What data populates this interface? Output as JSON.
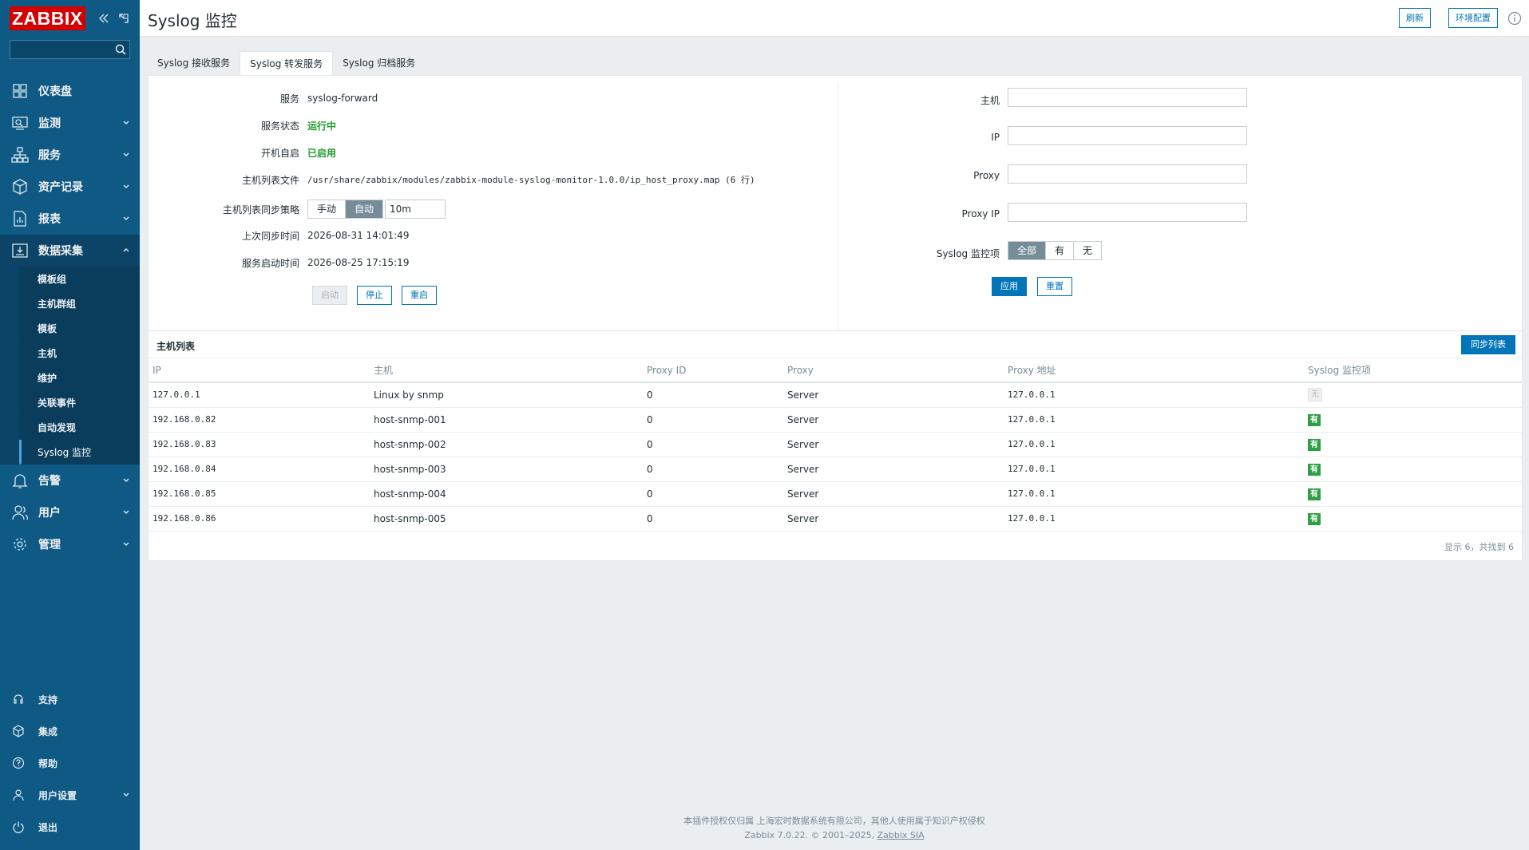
{
  "app": {
    "logo": "ZABBIX",
    "search_placeholder": ""
  },
  "sidebar": {
    "items": [
      {
        "name": "dashboard",
        "label": "仪表盘",
        "icon": "dashboard-icon",
        "has_arrow": false
      },
      {
        "name": "monitoring",
        "label": "监测",
        "icon": "monitoring-icon",
        "has_arrow": true
      },
      {
        "name": "services",
        "label": "服务",
        "icon": "services-icon",
        "has_arrow": true
      },
      {
        "name": "inventory",
        "label": "资产记录",
        "icon": "inventory-icon",
        "has_arrow": true
      },
      {
        "name": "reports",
        "label": "报表",
        "icon": "reports-icon",
        "has_arrow": true
      },
      {
        "name": "data-collection",
        "label": "数据采集",
        "icon": "data-collection-icon",
        "has_arrow": true,
        "open": true
      }
    ],
    "submenu": [
      "模板组",
      "主机群组",
      "模板",
      "主机",
      "维护",
      "关联事件",
      "自动发现",
      "Syslog 监控"
    ],
    "items_after": [
      {
        "name": "alerts",
        "label": "告警",
        "icon": "bell-icon"
      },
      {
        "name": "users",
        "label": "用户",
        "icon": "user-icon"
      },
      {
        "name": "administration",
        "label": "管理",
        "icon": "gear-icon"
      }
    ],
    "bottom": [
      {
        "name": "support",
        "label": "支持",
        "icon": "headset-icon",
        "has_arrow": false
      },
      {
        "name": "integrations",
        "label": "集成",
        "icon": "integrations-icon",
        "has_arrow": false
      },
      {
        "name": "help",
        "label": "帮助",
        "icon": "help-icon",
        "has_arrow": false
      },
      {
        "name": "user-settings",
        "label": "用户设置",
        "icon": "user-settings-icon",
        "has_arrow": true
      },
      {
        "name": "sign-out",
        "label": "退出",
        "icon": "power-icon",
        "has_arrow": false
      }
    ]
  },
  "header": {
    "title": "Syslog 监控",
    "refresh": "刷新",
    "env_config": "环境配置"
  },
  "tabs": [
    "Syslog 接收服务",
    "Syslog 转发服务",
    "Syslog 归档服务"
  ],
  "service": {
    "service_label": "服务",
    "service_value": "syslog-forward",
    "status_label": "服务状态",
    "status_value": "运行中",
    "autostart_label": "开机自启",
    "autostart_value": "已启用",
    "hostfile_label": "主机列表文件",
    "hostfile_value": "/usr/share/zabbix/modules/zabbix-module-syslog-monitor-1.0.0/ip_host_proxy.map (6 行)",
    "sync_label": "主机列表同步策略",
    "sync_manual": "手动",
    "sync_auto": "自动",
    "sync_interval": "10m",
    "last_sync_label": "上次同步时间",
    "last_sync_value": "2026-08-31 14:01:49",
    "start_time_label": "服务启动时间",
    "start_time_value": "2026-08-25 17:15:19",
    "btn_start": "启动",
    "btn_stop": "停止",
    "btn_restart": "重启"
  },
  "filter": {
    "host_label": "主机",
    "host_value": "",
    "ip_label": "IP",
    "ip_value": "",
    "proxy_label": "Proxy",
    "proxy_value": "",
    "proxy_ip_label": "Proxy IP",
    "proxy_ip_value": "",
    "syslog_label": "Syslog 监控项",
    "syslog_all": "全部",
    "syslog_yes": "有",
    "syslog_no": "无",
    "apply": "应用",
    "reset": "重置"
  },
  "host_list": {
    "title": "主机列表",
    "sync_button": "同步列表",
    "columns": [
      "IP",
      "主机",
      "Proxy ID",
      "Proxy",
      "Proxy 地址",
      "Syslog 监控项"
    ],
    "rows": [
      {
        "ip": "127.0.0.1",
        "host": "Linux by snmp",
        "proxy_id": "0",
        "proxy": "Server",
        "proxy_addr": "127.0.0.1",
        "syslog": "无",
        "has": false
      },
      {
        "ip": "192.168.0.82",
        "host": "host-snmp-001",
        "proxy_id": "0",
        "proxy": "Server",
        "proxy_addr": "127.0.0.1",
        "syslog": "有",
        "has": true
      },
      {
        "ip": "192.168.0.83",
        "host": "host-snmp-002",
        "proxy_id": "0",
        "proxy": "Server",
        "proxy_addr": "127.0.0.1",
        "syslog": "有",
        "has": true
      },
      {
        "ip": "192.168.0.84",
        "host": "host-snmp-003",
        "proxy_id": "0",
        "proxy": "Server",
        "proxy_addr": "127.0.0.1",
        "syslog": "有",
        "has": true
      },
      {
        "ip": "192.168.0.85",
        "host": "host-snmp-004",
        "proxy_id": "0",
        "proxy": "Server",
        "proxy_addr": "127.0.0.1",
        "syslog": "有",
        "has": true
      },
      {
        "ip": "192.168.0.86",
        "host": "host-snmp-005",
        "proxy_id": "0",
        "proxy": "Server",
        "proxy_addr": "127.0.0.1",
        "syslog": "有",
        "has": true
      }
    ],
    "footer": "显示 6，共找到 6"
  },
  "footer": {
    "license": "本插件授权仅归属 上海宏时数据系统有限公司，其他人使用属于知识产权侵权",
    "version": "Zabbix 7.0.22. © 2001–2025,",
    "company": "Zabbix SIA"
  },
  "colors": {
    "sidebar": "#0e5a85",
    "accent": "#0275b8",
    "logo": "#d40000",
    "ok": "#1f9e2d"
  }
}
